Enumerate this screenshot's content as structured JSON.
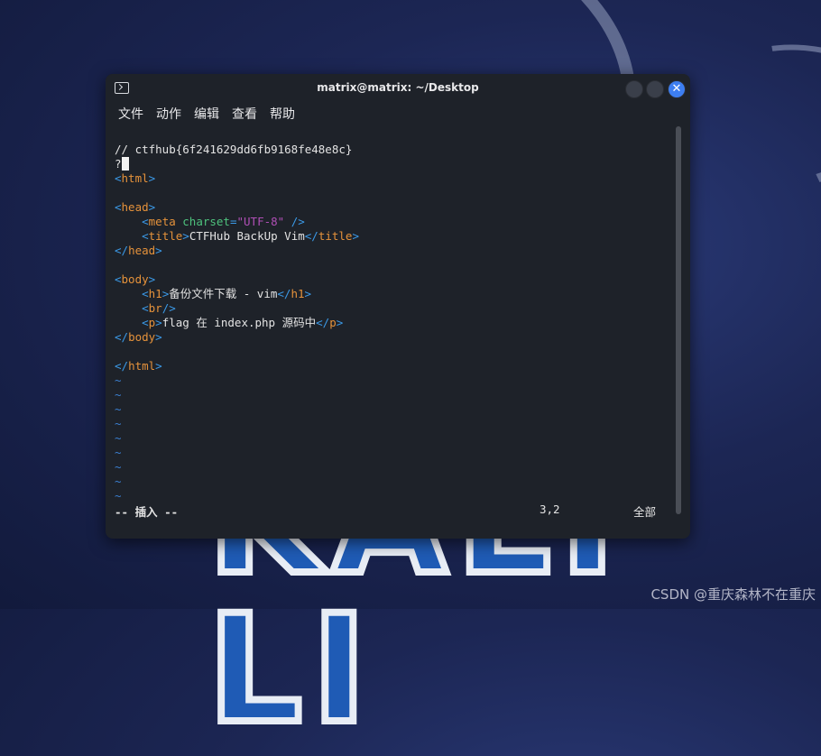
{
  "desktop": {
    "logo_text": "KALI LI",
    "watermark": "CSDN @重庆森林不在重庆"
  },
  "window": {
    "title": "matrix@matrix: ~/Desktop",
    "menu": [
      "文件",
      "动作",
      "编辑",
      "查看",
      "帮助"
    ]
  },
  "editor": {
    "line1": "// ctfhub{6f241629dd6fb9168fe48e8c}",
    "line2": "?",
    "html_tag": "html",
    "head_tag": "head",
    "meta_tag": "meta",
    "meta_attr": "charset",
    "meta_value": "\"UTF-8\"",
    "title_tag": "title",
    "title_text": "CTFHub BackUp Vim",
    "body_tag": "body",
    "h1_tag": "h1",
    "h1_text": "备份文件下载 - vim",
    "br_tag": "br",
    "p_tag": "p",
    "p_text": "flag 在 index.php 源码中",
    "tilde": "~",
    "mode": "-- 插入 --",
    "position": "3,2",
    "scroll": "全部"
  },
  "colors": {
    "tag": "#3b9ae8",
    "tagname": "#e5923b",
    "attr": "#4ec27d",
    "string": "#b04fb6",
    "close_button": "#3d7ef0"
  }
}
